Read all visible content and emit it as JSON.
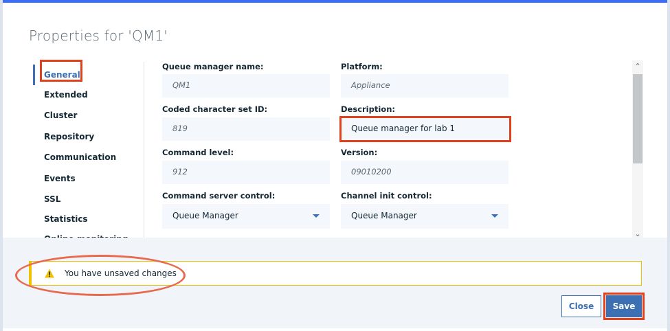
{
  "dialog": {
    "title": "Properties for 'QM1'"
  },
  "nav": {
    "items": [
      {
        "label": "General",
        "active": true
      },
      {
        "label": "Extended"
      },
      {
        "label": "Cluster"
      },
      {
        "label": "Repository"
      },
      {
        "label": "Communication"
      },
      {
        "label": "Events"
      },
      {
        "label": "SSL"
      },
      {
        "label": "Statistics"
      },
      {
        "label": "Online monitoring"
      }
    ]
  },
  "fields": {
    "qm_name": {
      "label": "Queue manager name:",
      "value": "QM1"
    },
    "platform": {
      "label": "Platform:",
      "value": "Appliance"
    },
    "ccsid": {
      "label": "Coded character set ID:",
      "value": "819"
    },
    "description": {
      "label": "Description:",
      "value": "Queue manager for lab 1"
    },
    "command_level": {
      "label": "Command level:",
      "value": "912"
    },
    "version": {
      "label": "Version:",
      "value": "09010200"
    },
    "command_server": {
      "label": "Command server control:",
      "value": "Queue Manager"
    },
    "channel_init": {
      "label": "Channel init control:",
      "value": "Queue Manager"
    }
  },
  "notification": {
    "message": "You have unsaved changes",
    "icon": "warning-icon"
  },
  "buttons": {
    "close": "Close",
    "save": "Save"
  },
  "colors": {
    "accent": "#3d70b2",
    "warning": "#efc100",
    "highlight": "#e0401c"
  }
}
